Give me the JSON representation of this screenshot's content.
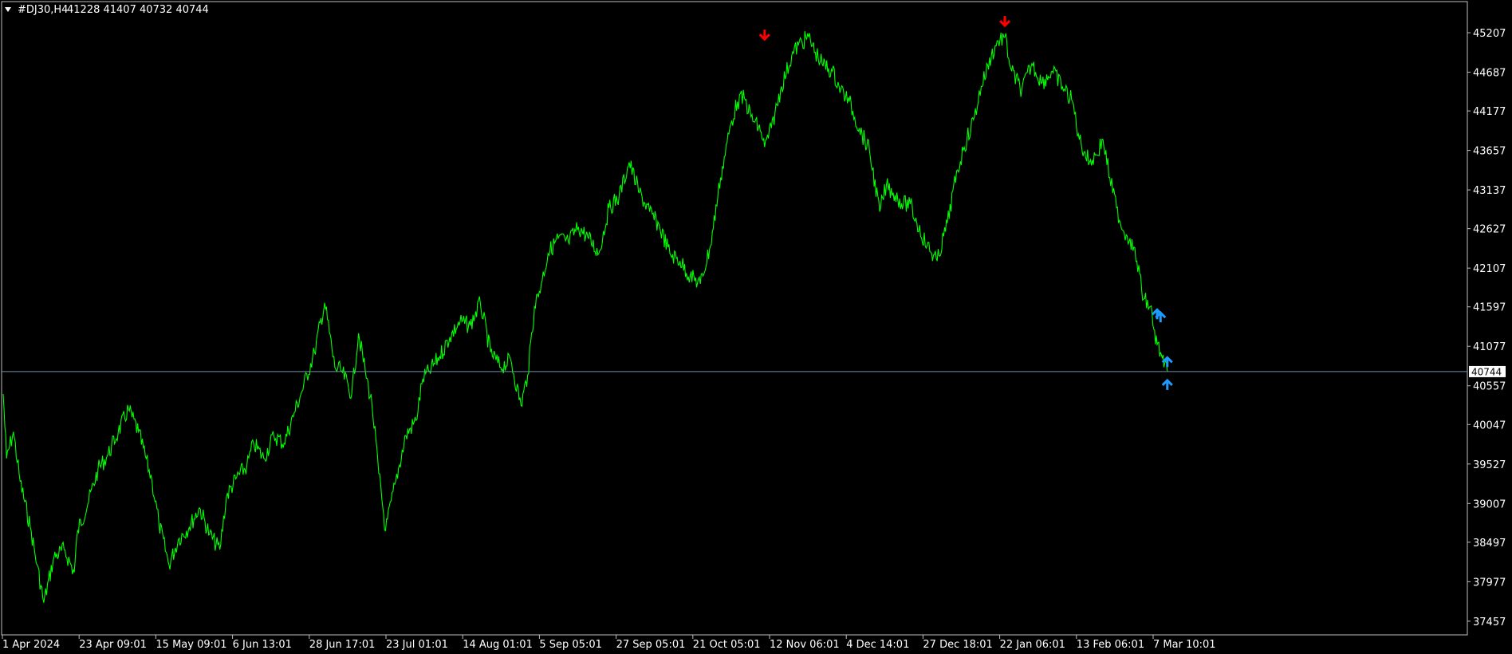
{
  "header": {
    "symbol_tf": "#DJ30,H4",
    "ohlc": "41228 41407 40732 40744"
  },
  "colors": {
    "background": "#000000",
    "border": "#c0c0c0",
    "price_line": "#00ff00",
    "current_line": "#6f8fa8",
    "sell_arrow": "#ff0000",
    "buy_arrow": "#1e9bff",
    "text": "#ffffff"
  },
  "chart_data": {
    "type": "line",
    "symbol": "#DJ30",
    "timeframe": "H4",
    "ohlc_last": {
      "open": 41228,
      "high": 41407,
      "low": 40732,
      "close": 40744
    },
    "current_price": 40744,
    "current_price_label": "40744",
    "y_ticks": [
      45207,
      44687,
      44177,
      43657,
      43137,
      42627,
      42107,
      41597,
      41077,
      40557,
      40047,
      39527,
      39007,
      38497,
      37977,
      37457
    ],
    "x_ticks": [
      "1 Apr 2024",
      "23 Apr 09:01",
      "15 May 09:01",
      "6 Jun 13:01",
      "28 Jun 17:01",
      "23 Jul 01:01",
      "14 Aug 01:01",
      "5 Sep 05:01",
      "27 Sep 05:01",
      "21 Oct 05:01",
      "12 Nov 06:01",
      "4 Dec 14:01",
      "27 Dec 18:01",
      "22 Jan 06:01",
      "13 Feb 06:01",
      "7 Mar 10:01"
    ],
    "x_range": [
      "2024-04-01",
      "2025-03-12"
    ],
    "y_range": [
      37277,
      45617
    ],
    "grid": false,
    "series": [
      {
        "x": [
          "2024-04-01",
          "2024-04-02",
          "2024-04-04",
          "2024-04-06",
          "2024-04-09",
          "2024-04-11",
          "2024-04-13",
          "2024-04-16",
          "2024-04-19",
          "2024-04-22",
          "2024-04-23",
          "2024-04-26",
          "2024-04-29",
          "2024-05-02",
          "2024-05-05",
          "2024-05-08",
          "2024-05-11",
          "2024-05-15",
          "2024-05-17",
          "2024-05-20",
          "2024-05-23",
          "2024-05-26",
          "2024-05-29",
          "2024-06-01",
          "2024-06-04",
          "2024-06-06",
          "2024-06-09",
          "2024-06-12",
          "2024-06-14",
          "2024-06-17",
          "2024-06-20",
          "2024-06-23",
          "2024-06-26",
          "2024-06-28",
          "2024-07-02",
          "2024-07-05",
          "2024-07-08",
          "2024-07-10",
          "2024-07-13",
          "2024-07-15",
          "2024-07-17",
          "2024-07-19",
          "2024-07-21",
          "2024-07-23",
          "2024-07-26",
          "2024-07-29",
          "2024-08-01",
          "2024-08-03",
          "2024-08-05",
          "2024-08-08",
          "2024-08-11",
          "2024-08-14",
          "2024-08-17",
          "2024-08-20",
          "2024-08-23",
          "2024-08-26",
          "2024-08-29",
          "2024-09-01",
          "2024-09-03",
          "2024-09-05",
          "2024-09-07",
          "2024-09-09",
          "2024-09-12",
          "2024-09-15",
          "2024-09-18",
          "2024-09-21",
          "2024-09-24",
          "2024-09-27",
          "2024-09-30",
          "2024-10-03",
          "2024-10-06",
          "2024-10-09",
          "2024-10-12",
          "2024-10-15",
          "2024-10-18",
          "2024-10-21",
          "2024-10-24",
          "2024-10-27",
          "2024-10-30",
          "2024-11-02",
          "2024-11-04",
          "2024-11-06",
          "2024-11-08",
          "2024-11-11",
          "2024-11-12",
          "2024-11-14",
          "2024-11-17",
          "2024-11-20",
          "2024-11-22",
          "2024-11-25",
          "2024-11-27",
          "2024-11-29",
          "2024-12-02",
          "2024-12-04",
          "2024-12-07",
          "2024-12-10",
          "2024-12-13",
          "2024-12-16",
          "2024-12-18",
          "2024-12-20",
          "2024-12-23",
          "2024-12-25",
          "2024-12-27",
          "2024-12-30",
          "2025-01-02",
          "2025-01-05",
          "2025-01-08",
          "2025-01-10",
          "2025-01-13",
          "2025-01-15",
          "2025-01-18",
          "2025-01-20",
          "2025-01-22",
          "2025-01-24",
          "2025-01-27",
          "2025-01-30",
          "2025-02-02",
          "2025-02-05",
          "2025-02-08",
          "2025-02-11",
          "2025-02-13",
          "2025-02-16",
          "2025-02-18",
          "2025-02-20",
          "2025-02-22",
          "2025-02-24",
          "2025-02-26",
          "2025-02-28",
          "2025-03-02",
          "2025-03-04",
          "2025-03-06",
          "2025-03-07",
          "2025-03-08",
          "2025-03-09",
          "2025-03-10",
          "2025-03-11"
        ],
        "values": [
          40450,
          39600,
          39950,
          39300,
          38700,
          38200,
          37700,
          38300,
          38400,
          38100,
          38650,
          39000,
          39450,
          39650,
          39950,
          40250,
          39950,
          39300,
          38750,
          38200,
          38550,
          38700,
          38950,
          38600,
          38400,
          39100,
          39350,
          39500,
          39800,
          39600,
          39900,
          39800,
          40200,
          40450,
          41000,
          41650,
          40800,
          40750,
          40450,
          41250,
          40750,
          40300,
          39400,
          38650,
          39300,
          39900,
          40100,
          40650,
          40750,
          40950,
          41200,
          41400,
          41350,
          41650,
          41000,
          40800,
          40900,
          40300,
          40700,
          41600,
          41900,
          42300,
          42500,
          42450,
          42650,
          42500,
          42300,
          42900,
          43050,
          43500,
          43100,
          42850,
          42650,
          42300,
          42200,
          42000,
          41900,
          42400,
          43300,
          44000,
          44300,
          44350,
          44100,
          43900,
          43700,
          43950,
          44500,
          44900,
          45050,
          45150,
          44950,
          44800,
          44700,
          44500,
          44300,
          43950,
          43650,
          42850,
          43200,
          43100,
          42950,
          42950,
          42700,
          42400,
          42200,
          42700,
          43400,
          43700,
          44100,
          44500,
          44900,
          45100,
          45150,
          44700,
          44450,
          44800,
          44550,
          44700,
          44500,
          44300,
          43800,
          43500,
          43600,
          43800,
          43300,
          42900,
          42600,
          42500,
          42200,
          41700,
          41600,
          41300,
          41100,
          41000,
          40800,
          40744
        ]
      }
    ],
    "annotations": [
      {
        "type": "sell_arrow",
        "x": "2024-11-12",
        "y": 45100
      },
      {
        "type": "sell_arrow",
        "x": "2025-01-22",
        "y": 45280
      },
      {
        "type": "buy_arrow",
        "x": "2025-03-08",
        "y": 41580
      },
      {
        "type": "buy_arrow",
        "x": "2025-03-09",
        "y": 41540
      },
      {
        "type": "buy_arrow",
        "x": "2025-03-11",
        "y": 40950
      },
      {
        "type": "buy_arrow",
        "x": "2025-03-11",
        "y": 40650
      }
    ]
  }
}
